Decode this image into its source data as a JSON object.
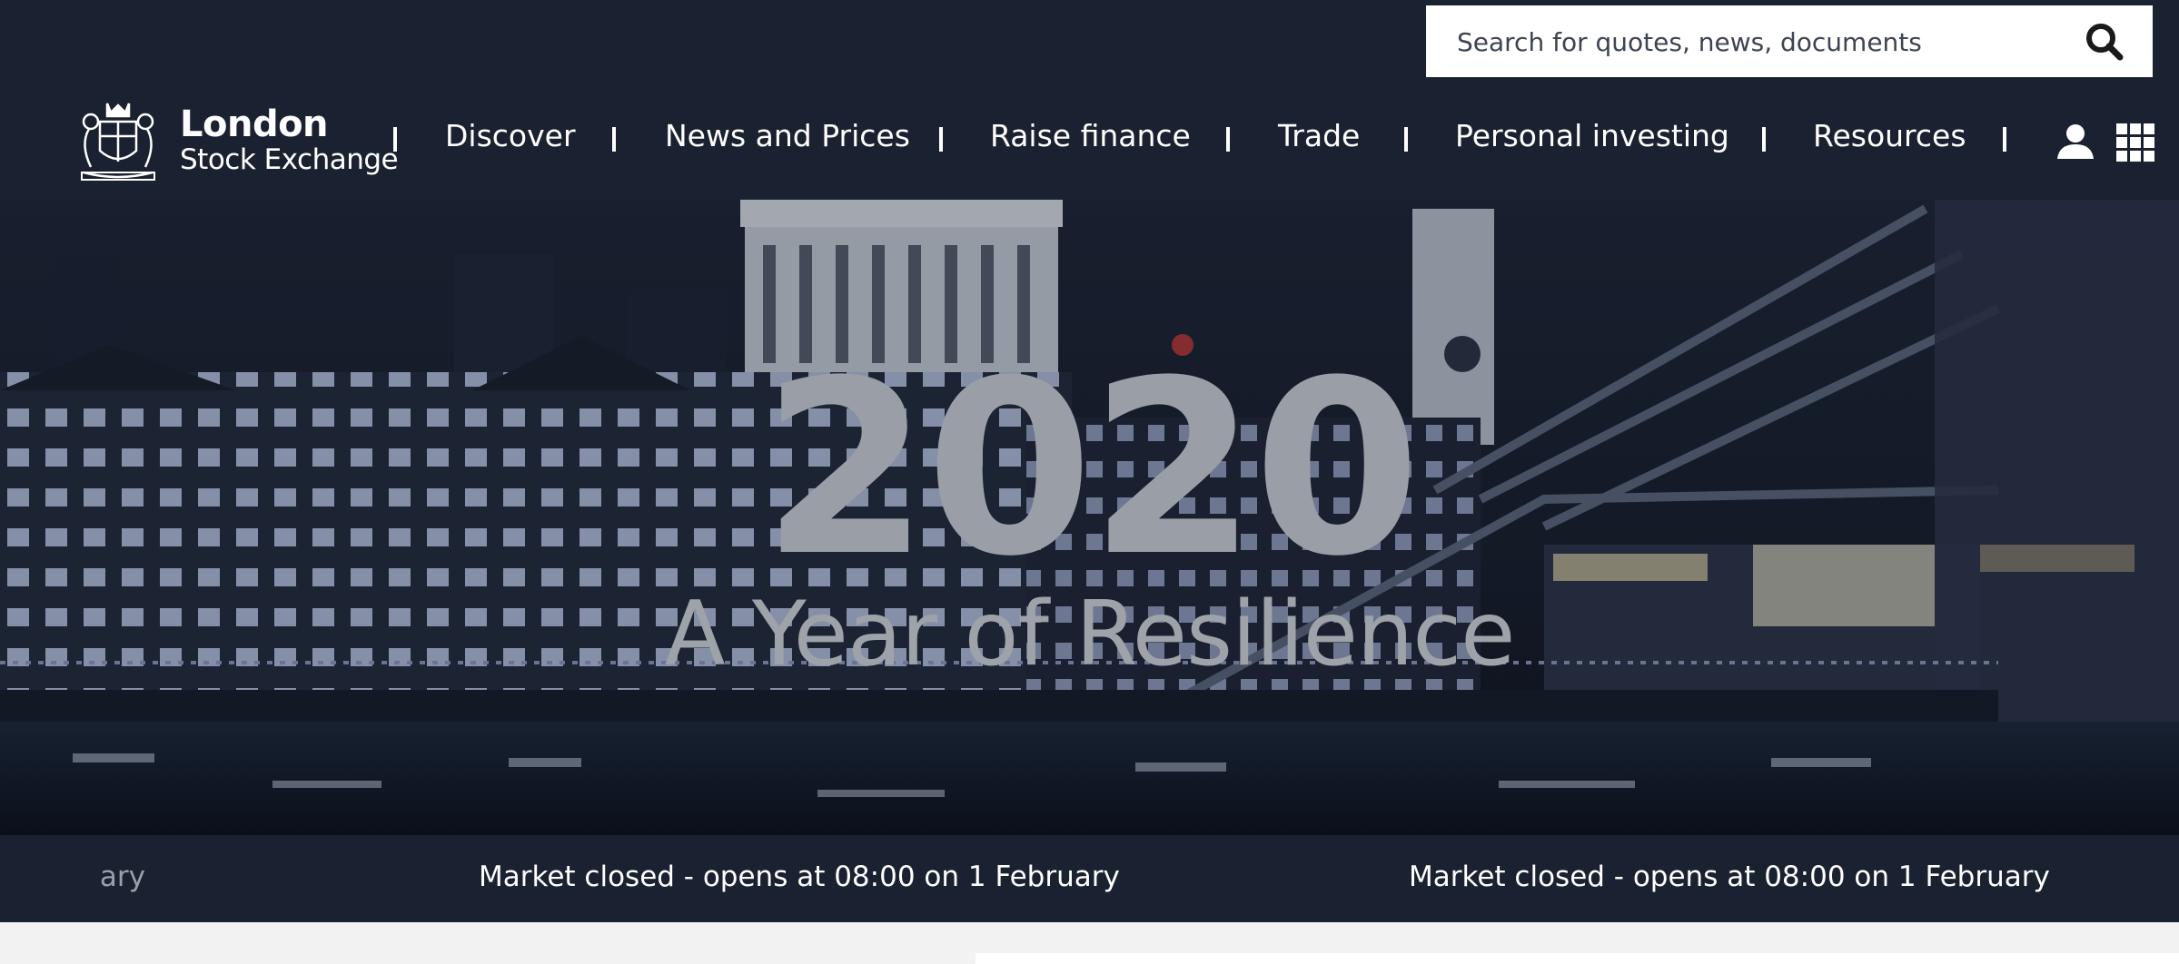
{
  "search": {
    "placeholder": "Search for quotes, news, documents",
    "icon": "search-icon"
  },
  "logo": {
    "line1": "London",
    "line2": "Stock Exchange",
    "icon": "crest-icon"
  },
  "nav": {
    "items": [
      {
        "label": "Discover"
      },
      {
        "label": "News and Prices"
      },
      {
        "label": "Raise finance"
      },
      {
        "label": "Trade"
      },
      {
        "label": "Personal investing"
      },
      {
        "label": "Resources"
      }
    ],
    "user_icon": "user-icon",
    "apps_icon": "apps-grid-icon"
  },
  "hero": {
    "year": "2020",
    "subtitle": "A Year of Resilience"
  },
  "ticker": {
    "fragment": "ary",
    "messages": [
      "Market closed - opens at 08:00 on 1 February",
      "Market closed - opens at 08:00 on 1 February"
    ]
  },
  "colors": {
    "header_bg": "#1a2130",
    "text_light": "#ffffff",
    "hero_text": "#9a9ea6"
  }
}
